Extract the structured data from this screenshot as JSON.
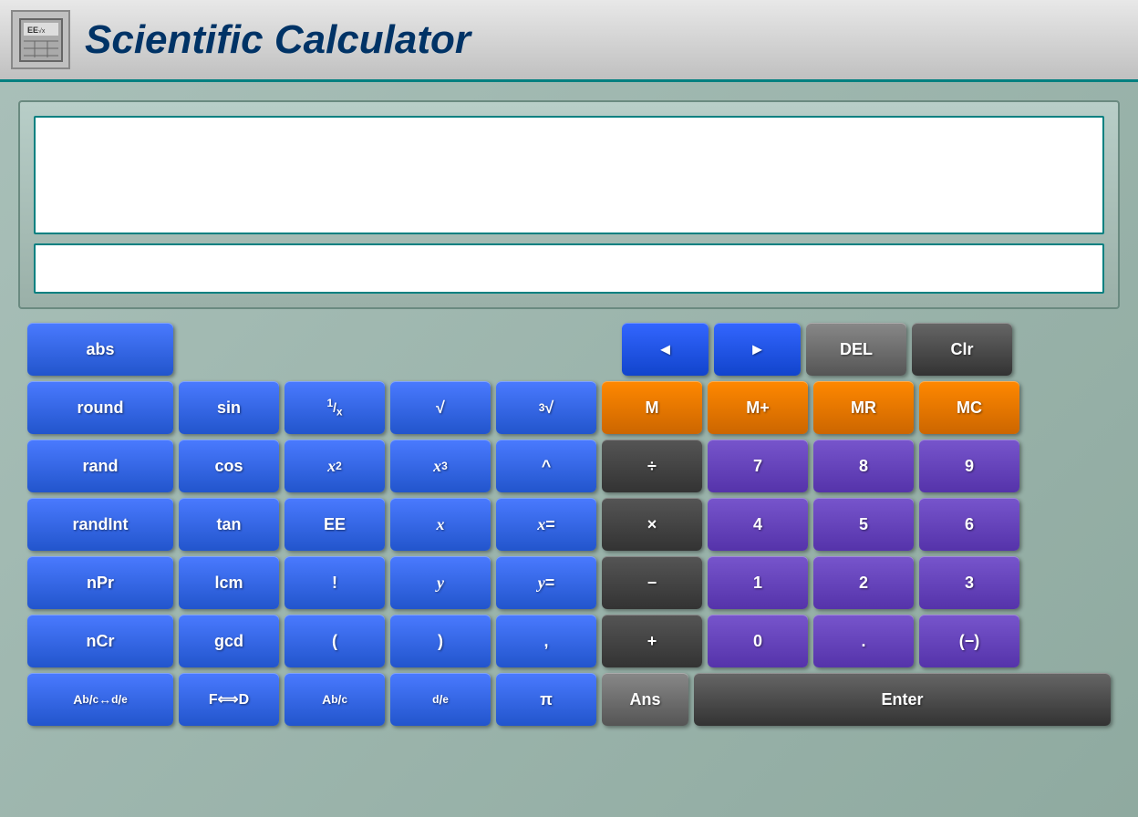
{
  "title": "Scientific Calculator",
  "displays": {
    "main_placeholder": "",
    "secondary_placeholder": ""
  },
  "buttons": {
    "row0": [
      {
        "id": "abs",
        "label": "abs",
        "class": "btn-blue",
        "width": 160
      },
      {
        "id": "left-arrow",
        "label": "◄",
        "class": "btn-nav"
      },
      {
        "id": "right-arrow",
        "label": "►",
        "class": "btn-nav"
      },
      {
        "id": "del",
        "label": "DEL",
        "class": "btn-del"
      },
      {
        "id": "clr",
        "label": "Clr",
        "class": "btn-clr"
      }
    ],
    "row1": [
      {
        "id": "round",
        "label": "round",
        "class": "btn-blue",
        "width": 160
      },
      {
        "id": "sin",
        "label": "sin",
        "class": "btn-blue-sm"
      },
      {
        "id": "inv-x",
        "label": "¹⁄ₓ",
        "class": "btn-blue-sm"
      },
      {
        "id": "sqrt",
        "label": "√",
        "class": "btn-blue-sm"
      },
      {
        "id": "cbrt",
        "label": "³√",
        "class": "btn-blue-sm"
      },
      {
        "id": "M",
        "label": "M",
        "class": "btn-orange"
      },
      {
        "id": "Mplus",
        "label": "M+",
        "class": "btn-orange"
      },
      {
        "id": "MR",
        "label": "MR",
        "class": "btn-orange"
      },
      {
        "id": "MC",
        "label": "MC",
        "class": "btn-orange"
      }
    ],
    "row2": [
      {
        "id": "rand",
        "label": "rand",
        "class": "btn-blue",
        "width": 160
      },
      {
        "id": "cos",
        "label": "cos",
        "class": "btn-blue-sm"
      },
      {
        "id": "x2",
        "label": "x²",
        "class": "btn-blue-sm"
      },
      {
        "id": "x3",
        "label": "x³",
        "class": "btn-blue-sm"
      },
      {
        "id": "caret",
        "label": "^",
        "class": "btn-blue-sm"
      },
      {
        "id": "divide",
        "label": "÷",
        "class": "btn-dark-gray"
      },
      {
        "id": "7",
        "label": "7",
        "class": "btn-purple"
      },
      {
        "id": "8",
        "label": "8",
        "class": "btn-purple"
      },
      {
        "id": "9",
        "label": "9",
        "class": "btn-purple"
      }
    ],
    "row3": [
      {
        "id": "randInt",
        "label": "randInt",
        "class": "btn-blue",
        "width": 160
      },
      {
        "id": "tan",
        "label": "tan",
        "class": "btn-blue-sm"
      },
      {
        "id": "EE",
        "label": "EE",
        "class": "btn-blue-sm"
      },
      {
        "id": "x-var",
        "label": "x",
        "class": "btn-blue-sm"
      },
      {
        "id": "x-eq",
        "label": "x=",
        "class": "btn-blue-sm"
      },
      {
        "id": "multiply",
        "label": "×",
        "class": "btn-dark-gray"
      },
      {
        "id": "4",
        "label": "4",
        "class": "btn-purple"
      },
      {
        "id": "5",
        "label": "5",
        "class": "btn-purple"
      },
      {
        "id": "6",
        "label": "6",
        "class": "btn-purple"
      }
    ],
    "row4": [
      {
        "id": "nPr",
        "label": "nPr",
        "class": "btn-blue",
        "width": 160
      },
      {
        "id": "lcm",
        "label": "lcm",
        "class": "btn-blue-sm"
      },
      {
        "id": "factorial",
        "label": "!",
        "class": "btn-blue-sm"
      },
      {
        "id": "y-var",
        "label": "y",
        "class": "btn-blue-sm"
      },
      {
        "id": "y-eq",
        "label": "y=",
        "class": "btn-blue-sm"
      },
      {
        "id": "subtract",
        "label": "−",
        "class": "btn-dark-gray"
      },
      {
        "id": "1",
        "label": "1",
        "class": "btn-purple"
      },
      {
        "id": "2",
        "label": "2",
        "class": "btn-purple"
      },
      {
        "id": "3",
        "label": "3",
        "class": "btn-purple"
      }
    ],
    "row5": [
      {
        "id": "nCr",
        "label": "nCr",
        "class": "btn-blue",
        "width": 160
      },
      {
        "id": "gcd",
        "label": "gcd",
        "class": "btn-blue-sm"
      },
      {
        "id": "open-paren",
        "label": "(",
        "class": "btn-blue-sm"
      },
      {
        "id": "close-paren",
        "label": ")",
        "class": "btn-blue-sm"
      },
      {
        "id": "comma",
        "label": ",",
        "class": "btn-blue-sm"
      },
      {
        "id": "add",
        "label": "+",
        "class": "btn-dark-gray"
      },
      {
        "id": "0",
        "label": "0",
        "class": "btn-purple"
      },
      {
        "id": "decimal",
        "label": ".",
        "class": "btn-purple"
      },
      {
        "id": "negate",
        "label": "(−)",
        "class": "btn-purple"
      }
    ],
    "row6": [
      {
        "id": "frac-conv",
        "label": "Aᵇ/꜀ ↔ ᵈ/ₑ",
        "class": "btn-blue",
        "width": 160
      },
      {
        "id": "f-to-d",
        "label": "F⟺D",
        "class": "btn-blue-sm"
      },
      {
        "id": "frac",
        "label": "Aᵇ/꜀",
        "class": "btn-blue-sm"
      },
      {
        "id": "d-e",
        "label": "ᵈ/ₑ",
        "class": "btn-blue-sm"
      },
      {
        "id": "pi",
        "label": "π",
        "class": "btn-blue-sm"
      },
      {
        "id": "ans",
        "label": "Ans",
        "class": "btn-ans"
      },
      {
        "id": "enter",
        "label": "Enter",
        "class": "btn-enter"
      }
    ]
  }
}
